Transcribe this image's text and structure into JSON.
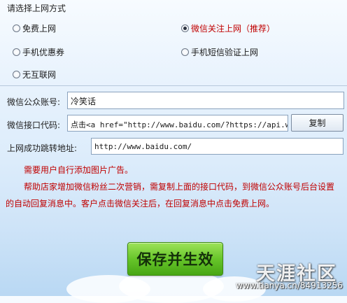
{
  "login_mode": {
    "title": "请选择上网方式",
    "options": [
      {
        "label": "免费上网",
        "selected": false
      },
      {
        "label": "微信关注上网（推荐）",
        "selected": true
      },
      {
        "label": "手机优惠券",
        "selected": false
      },
      {
        "label": "手机短信验证上网",
        "selected": false
      },
      {
        "label": "无互联网",
        "selected": false
      }
    ]
  },
  "form": {
    "wechat_account_label": "微信公众账号:",
    "wechat_account_value": "冷笑话",
    "api_code_label": "微信接口代码:",
    "api_code_value": "点击<a href=\"http://www.baidu.com/?https://api.weixin",
    "copy_button": "复制",
    "redirect_label": "上网成功跳转地址:",
    "redirect_value": "http://www.baidu.com/"
  },
  "notes": {
    "line1": "需要用户自行添加图片广告。",
    "line2": "帮助店家增加微信粉丝二次营销，需复制上面的接口代码，到微信公众账号后台设置",
    "line3": "的自动回复消息中。客户点击微信关注后，在回复消息中点击免费上网。"
  },
  "save_button": "保存并生效",
  "watermark": {
    "logo": "天涯社区",
    "url": "www.tianya.cn/84913256"
  },
  "colors": {
    "accent_red": "#c00000",
    "save_green": "#67c52a"
  }
}
